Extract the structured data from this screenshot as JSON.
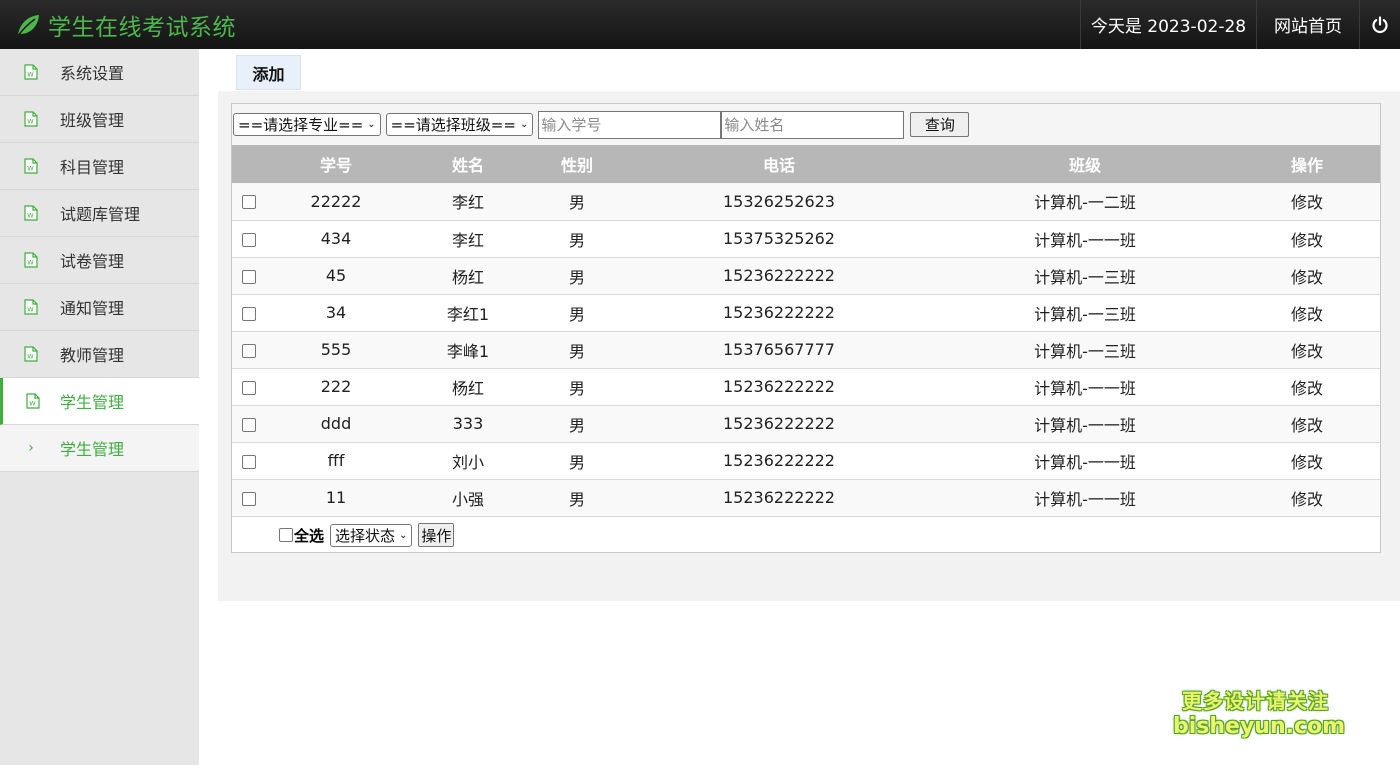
{
  "header": {
    "title": "学生在线考试系统",
    "date_text": "今天是 2023-02-28",
    "home_link": "网站首页",
    "icons": {
      "logo": "leaf-icon",
      "power": "power-icon"
    },
    "brand_color": "#4cb84c"
  },
  "sidebar": {
    "items": [
      {
        "label": "系统设置"
      },
      {
        "label": "班级管理"
      },
      {
        "label": "科目管理"
      },
      {
        "label": "试题库管理"
      },
      {
        "label": "试卷管理"
      },
      {
        "label": "通知管理"
      },
      {
        "label": "教师管理"
      },
      {
        "label": "学生管理"
      }
    ],
    "active_item": "学生管理",
    "sub_item": {
      "label": "学生管理"
    },
    "active_color": "#3fae3f"
  },
  "toolbar": {
    "add_label": "添加"
  },
  "filters": {
    "major_select": "==请选择专业==",
    "class_select": "==请选择班级==",
    "student_no_placeholder": "输入学号",
    "name_placeholder": "输入姓名",
    "query_label": "查询"
  },
  "table": {
    "headers": [
      "学号",
      "姓名",
      "性别",
      "电话",
      "班级",
      "操作"
    ],
    "rows": [
      [
        "22222",
        "李红",
        "男",
        "15326252623",
        "计算机-一二班",
        "修改"
      ],
      [
        "434",
        "李红",
        "男",
        "15375325262",
        "计算机-一一班",
        "修改"
      ],
      [
        "45",
        "杨红",
        "男",
        "15236222222",
        "计算机-一三班",
        "修改"
      ],
      [
        "34",
        "李红1",
        "男",
        "15236222222",
        "计算机-一三班",
        "修改"
      ],
      [
        "555",
        "李峰1",
        "男",
        "15376567777",
        "计算机-一三班",
        "修改"
      ],
      [
        "222",
        "杨红",
        "男",
        "15236222222",
        "计算机-一一班",
        "修改"
      ],
      [
        "ddd",
        "333",
        "男",
        "15236222222",
        "计算机-一一班",
        "修改"
      ],
      [
        "fff",
        "刘小",
        "男",
        "15236222222",
        "计算机-一一班",
        "修改"
      ],
      [
        "11",
        "小强",
        "男",
        "15236222222",
        "计算机-一一班",
        "修改"
      ]
    ]
  },
  "footer": {
    "select_all": "全选",
    "status_select": "选择状态",
    "operate_label": "操作"
  },
  "watermark": {
    "line1": "更多设计请关注",
    "line2": "bisheyun.com"
  }
}
